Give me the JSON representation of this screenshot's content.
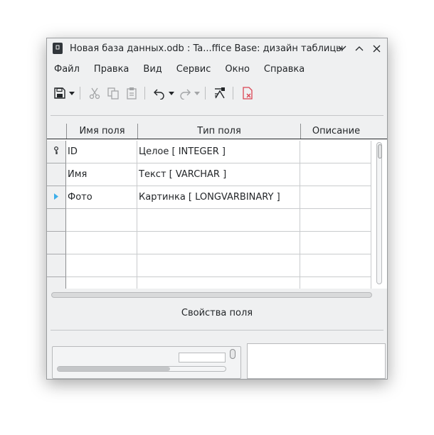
{
  "window": {
    "title": "Новая база данных.odb : Ta...ffice Base: дизайн таблицы",
    "app_icon": "document-icon",
    "controls": [
      "minimize-icon",
      "maximize-icon",
      "close-icon"
    ]
  },
  "menu": {
    "items": [
      "Файл",
      "Правка",
      "Вид",
      "Сервис",
      "Окно",
      "Справка"
    ]
  },
  "toolbar": {
    "buttons": [
      "save-icon",
      "dropdown-arrow-icon",
      "cut-icon",
      "copy-icon",
      "paste-icon",
      "undo-icon",
      "dropdown-arrow-icon",
      "redo-icon",
      "dropdown-arrow-icon",
      "index-design-icon",
      "delete-rows-icon"
    ]
  },
  "table": {
    "columns": [
      "Имя поля",
      "Тип поля",
      "Описание"
    ],
    "rows": [
      {
        "marker": "primary-key-icon",
        "name": "ID",
        "type": "Целое [ INTEGER ]",
        "description": ""
      },
      {
        "marker": "",
        "name": "Имя",
        "type": "Текст [ VARCHAR ]",
        "description": ""
      },
      {
        "marker": "current-row-arrow-icon",
        "name": "Фото",
        "type": "Картинка [ LONGVARBINARY ]",
        "description": ""
      },
      {
        "marker": "",
        "name": "",
        "type": "",
        "description": ""
      },
      {
        "marker": "",
        "name": "",
        "type": "",
        "description": ""
      },
      {
        "marker": "",
        "name": "",
        "type": "",
        "description": ""
      },
      {
        "marker": "",
        "name": "",
        "type": "",
        "description": ""
      }
    ]
  },
  "field_properties": {
    "label": "Свойства поля"
  },
  "colors": {
    "window_bg": "#eff0f1",
    "text": "#232629",
    "accent": "#3daee9",
    "delete_red": "#da4453"
  }
}
